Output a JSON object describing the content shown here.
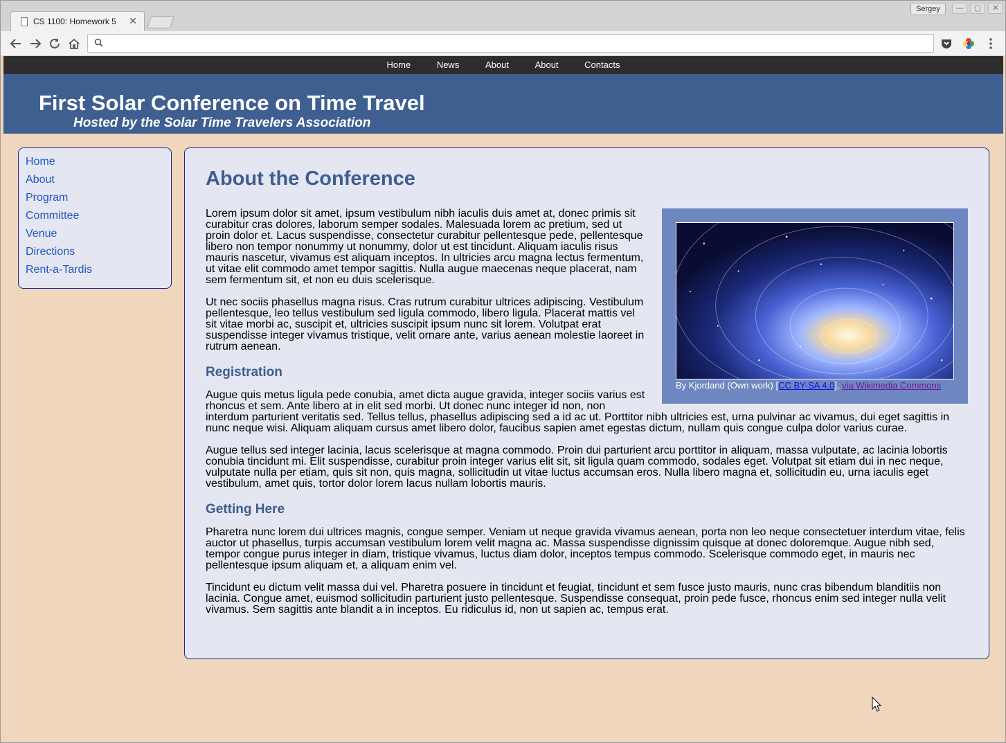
{
  "browser": {
    "tab_title": "CS 1100: Homework 5",
    "user_name": "Sergey",
    "address": ""
  },
  "nav": {
    "items": [
      "Home",
      "News",
      "About",
      "About",
      "Contacts"
    ]
  },
  "banner": {
    "title": "First Solar Conference on Time Travel",
    "subtitle": "Hosted by the Solar Time Travelers Association"
  },
  "sidebar": {
    "items": [
      "Home",
      "About",
      "Program",
      "Committee",
      "Venue",
      "Directions",
      "Rent-a-Tardis"
    ]
  },
  "main": {
    "heading": "About the Conference",
    "figure": {
      "caption_prefix": "By Kjordand (Own work) [",
      "license_link": "CC BY-SA 4.0",
      "sep": "], ",
      "source_link": "via Wikimedia Commons"
    },
    "p1": "Lorem ipsum dolor sit amet, ipsum vestibulum nibh iaculis duis amet at, donec primis sit curabitur cras dolores, laborum semper sodales. Malesuada lorem ac pretium, sed ut proin dolor et. Lacus suspendisse, consectetur curabitur pellentesque pede, pellentesque libero non tempor nonummy ut nonummy, dolor ut est tincidunt. Aliquam iaculis risus mauris nascetur, vivamus est aliquam inceptos. In ultricies arcu magna lectus fermentum, ut vitae elit commodo amet tempor sagittis. Nulla augue maecenas neque placerat, nam sem fermentum sit, et non eu duis scelerisque.",
    "p2": "Ut nec sociis phasellus magna risus. Cras rutrum curabitur ultrices adipiscing. Vestibulum pellentesque, leo tellus vestibulum sed ligula commodo, libero ligula. Placerat mattis vel sit vitae morbi ac, suscipit et, ultricies suscipit ipsum nunc sit lorem. Volutpat erat suspendisse integer vivamus tristique, velit ornare ante, varius aenean molestie laoreet in rutrum aenean.",
    "h_registration": "Registration",
    "p3": "Augue quis metus ligula pede conubia, amet dicta augue gravida, integer sociis varius est rhoncus et sem. Ante libero at in elit sed morbi. Ut donec nunc integer id non, non interdum parturient veritatis sed. Tellus tellus, phasellus adipiscing sed a id ac ut. Porttitor nibh ultricies est, urna pulvinar ac vivamus, dui eget sagittis in nunc neque wisi. Aliquam aliquam cursus amet libero dolor, faucibus sapien amet egestas dictum, nullam quis congue culpa dolor varius curae.",
    "p4": "Augue tellus sed integer lacinia, lacus scelerisque at magna commodo. Proin dui parturient arcu porttitor in aliquam, massa vulputate, ac lacinia lobortis conubia tincidunt mi. Elit suspendisse, curabitur proin integer varius elit sit, sit ligula quam commodo, sodales eget. Volutpat sit etiam dui in nec neque, vulputate nulla per etiam, quis sit non, quis magna, sollicitudin ut vitae luctus accumsan eros. Nulla libero magna et, sollicitudin eu, urna iaculis eget vestibulum, amet quis, tortor dolor lorem lacus nullam lobortis mauris.",
    "h_getting_here": "Getting Here",
    "p5": "Pharetra nunc lorem dui ultrices magnis, congue semper. Veniam ut neque gravida vivamus aenean, porta non leo neque consectetuer interdum vitae, felis auctor ut phasellus, turpis accumsan vestibulum lorem velit magna ac. Massa suspendisse dignissim quisque at donec doloremque. Augue nibh sed, tempor congue purus integer in diam, tristique vivamus, luctus diam dolor, inceptos tempus commodo. Scelerisque commodo eget, in mauris nec pellentesque ipsum aliquam et, a aliquam enim vel.",
    "p6": "Tincidunt eu dictum velit massa dui vel. Pharetra posuere in tincidunt et feugiat, tincidunt et sem fusce justo mauris, nunc cras bibendum blanditiis non lacinia. Congue amet, euismod sollicitudin parturient justo pellentesque. Suspendisse consequat, proin pede fusce, rhoncus enim sed integer nulla velit vivamus. Sem sagittis ante blandit a in inceptos. Eu ridiculus id, non ut sapien ac, tempus erat."
  },
  "icons": {
    "back": "back-arrow-icon",
    "forward": "forward-arrow-icon",
    "reload": "reload-icon",
    "home": "home-icon",
    "search": "search-icon",
    "pocket": "pocket-icon",
    "color_extension": "color-wheel-icon",
    "menu": "kebab-menu-icon"
  },
  "colors": {
    "banner": "#3f5f91",
    "nav": "#2d2d2d",
    "page_background": "#f0d6bd",
    "panel_background": "#e4e6f2",
    "heading": "#3d5e8f",
    "link": "#1f57c3",
    "figure_background": "#6f87c0"
  }
}
